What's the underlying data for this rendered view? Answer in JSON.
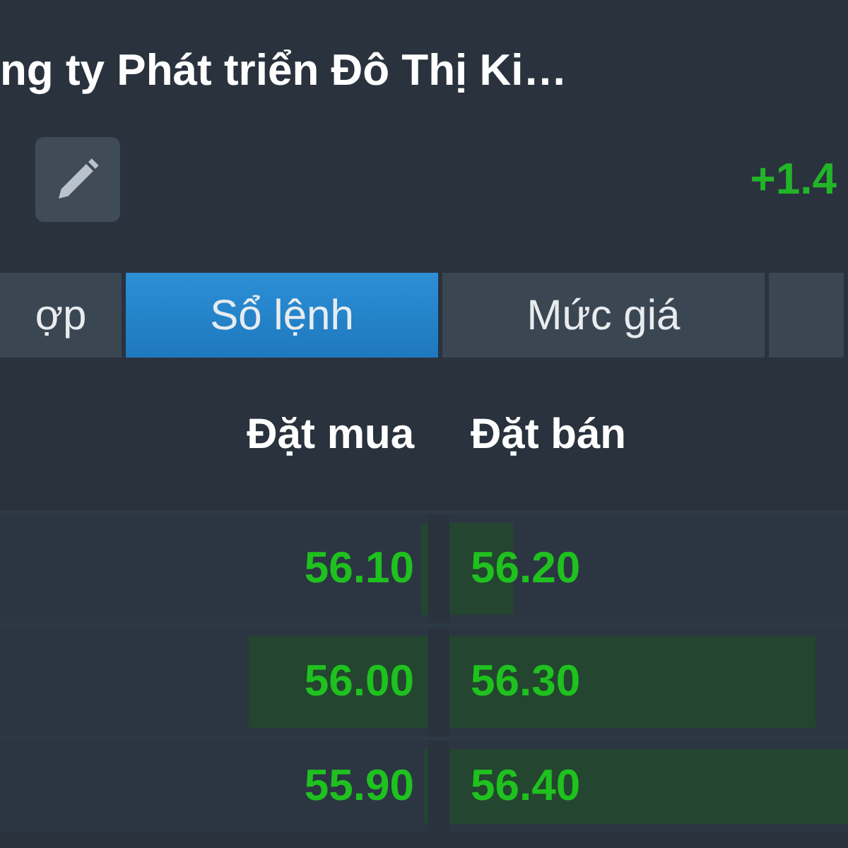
{
  "header": {
    "title": "ng ty Phát triển Đô Thị Ki…",
    "change": "+1.4"
  },
  "tabs": [
    {
      "label": "ợp",
      "selected": false
    },
    {
      "label": "Sổ lệnh",
      "selected": true
    },
    {
      "label": "Mức giá",
      "selected": false
    },
    {
      "selected": false
    }
  ],
  "order_book": {
    "columns": [
      "Đặt mua",
      "Đặt bán"
    ],
    "rows": [
      {
        "bid": {
          "price": "56.10",
          "level": 0.015
        },
        "ask": {
          "price": "56.20",
          "level": 0.16
        }
      },
      {
        "bid": {
          "price": "56.00",
          "level": 0.42
        },
        "ask": {
          "price": "56.30",
          "level": 0.92
        }
      },
      {
        "bid": {
          "price": "55.90",
          "level": 0.01
        },
        "ask": {
          "price": "56.40",
          "level": 1.0
        }
      }
    ]
  }
}
